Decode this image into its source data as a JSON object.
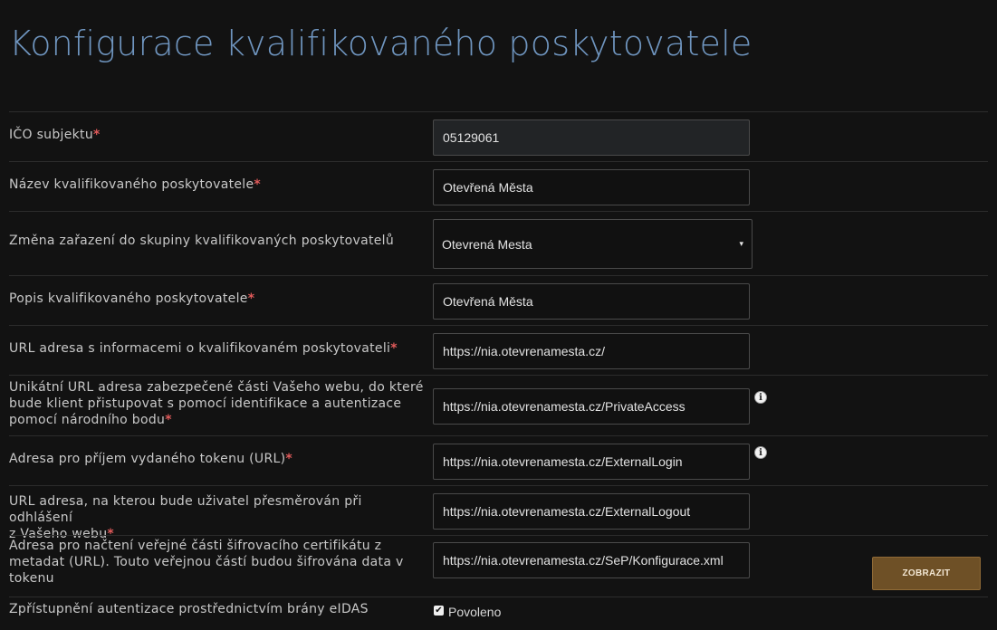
{
  "page": {
    "title": "Konfigurace kvalifikovaného poskytovatele"
  },
  "form": {
    "ico": {
      "label": "IČO subjektu",
      "required": "*",
      "value": "05129061"
    },
    "name": {
      "label": "Název kvalifikovaného poskytovatele",
      "required": "*",
      "value": "Otevřená Města"
    },
    "group": {
      "label": "Změna zařazení do skupiny kvalifikovaných poskytovatelů",
      "value": "Otevrená Mesta"
    },
    "description": {
      "label": "Popis kvalifikovaného poskytovatele",
      "required": "*",
      "value": "Otevřená Města"
    },
    "info_url": {
      "label": "URL adresa s informacemi o kvalifikovaném poskytovateli",
      "required": "*",
      "value": "https://nia.otevrenamesta.cz/"
    },
    "private_url": {
      "label_line1": "Unikátní URL adresa zabezpečené části Vašeho webu, do které",
      "label_line2": "bude klient přistupovat s pomocí identifikace a autentizace",
      "label_line3": "pomocí národního bodu",
      "required": "*",
      "value": "https://nia.otevrenamesta.cz/PrivateAccess"
    },
    "token_url": {
      "label": "Adresa pro příjem vydaného tokenu (URL)",
      "required": "*",
      "value": "https://nia.otevrenamesta.cz/ExternalLogin"
    },
    "logout_url": {
      "label_line1": "URL adresa, na kterou bude uživatel přesměrován při odhlášení",
      "label_line2": "z Vašeho webu",
      "required": "*",
      "value": "https://nia.otevrenamesta.cz/ExternalLogout"
    },
    "cert_url": {
      "label_line1": "Adresa pro načtení veřejné části šifrovacího certifikátu z",
      "label_line2": "metadat (URL). Touto veřejnou částí budou šifrována data v",
      "label_line3": "tokenu",
      "value": "https://nia.otevrenamesta.cz/SeP/Konfigurace.xml",
      "button_label": "ZOBRAZIT"
    },
    "eidas": {
      "label": "Zpřístupnění autentizace prostřednictvím brány eIDAS",
      "checkbox_label": "Povoleno",
      "checked": true
    }
  },
  "icons": {
    "info": "i",
    "caret": "▾",
    "check": "✔"
  }
}
